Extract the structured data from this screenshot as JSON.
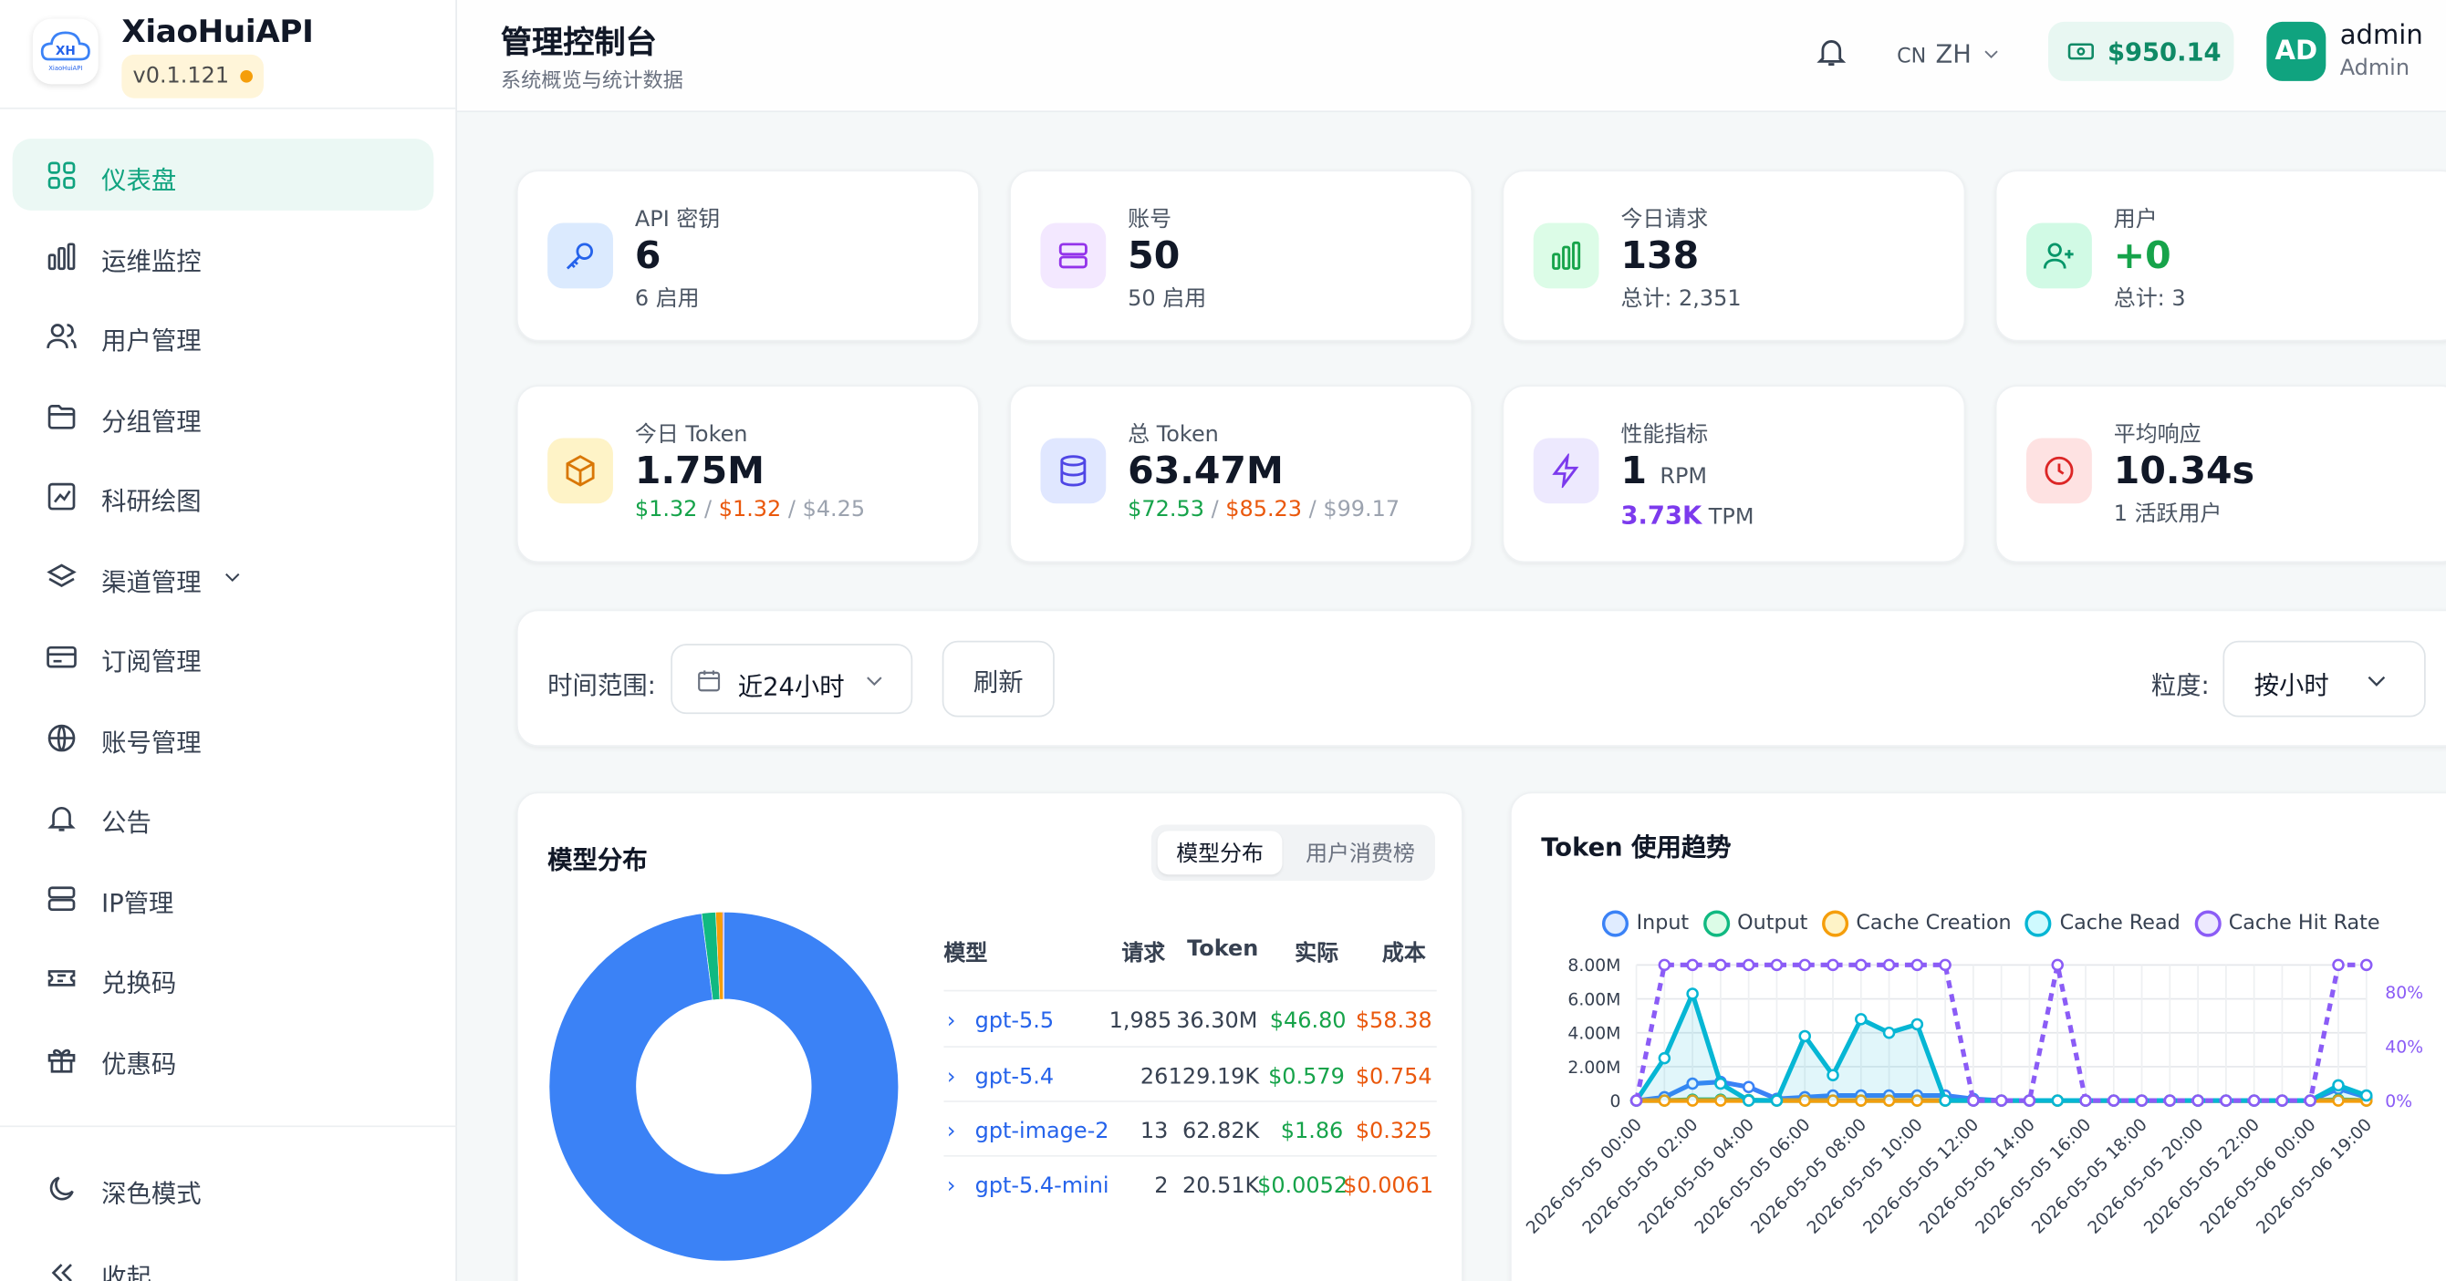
{
  "brand": {
    "name": "XiaoHuiAPI",
    "version": "v0.1.121",
    "logo_text": "XH"
  },
  "sidebar": {
    "items": [
      {
        "label": "仪表盘",
        "icon": "dashboard-icon",
        "active": true
      },
      {
        "label": "运维监控",
        "icon": "bar-chart-icon"
      },
      {
        "label": "用户管理",
        "icon": "users-icon"
      },
      {
        "label": "分组管理",
        "icon": "folder-icon"
      },
      {
        "label": "科研绘图",
        "icon": "line-chart-icon"
      },
      {
        "label": "渠道管理",
        "icon": "layers-icon",
        "expandable": true
      },
      {
        "label": "订阅管理",
        "icon": "card-icon"
      },
      {
        "label": "账号管理",
        "icon": "globe-icon"
      },
      {
        "label": "公告",
        "icon": "bell-icon"
      },
      {
        "label": "IP管理",
        "icon": "server-icon"
      },
      {
        "label": "兑换码",
        "icon": "ticket-icon"
      },
      {
        "label": "优惠码",
        "icon": "gift-icon"
      }
    ],
    "bottom": {
      "dark_mode": "深色模式",
      "collapse": "收起"
    }
  },
  "header": {
    "title": "管理控制台",
    "subtitle": "系统概览与统计数据",
    "lang_flag": "CN",
    "lang": "ZH",
    "balance": "$950.14",
    "avatar": "AD",
    "username": "admin",
    "role": "Admin"
  },
  "stats": [
    {
      "label": "API 密钥",
      "value": "6",
      "sub": "6 启用",
      "icon": "key-icon"
    },
    {
      "label": "账号",
      "value": "50",
      "sub": "50 启用",
      "icon": "server-stack-icon"
    },
    {
      "label": "今日请求",
      "value": "138",
      "sub": "总计: 2,351",
      "icon": "bar-chart-icon"
    },
    {
      "label": "用户",
      "value": "+0",
      "sub": "总计: 3",
      "icon": "user-plus-icon"
    },
    {
      "label": "今日 Token",
      "value": "1.75M",
      "sub_a": "$1.32",
      "sub_b": "$1.32",
      "sub_c": "$4.25",
      "icon": "box-icon"
    },
    {
      "label": "总 Token",
      "value": "63.47M",
      "sub_a": "$72.53",
      "sub_b": "$85.23",
      "sub_c": "$99.17",
      "icon": "database-icon"
    },
    {
      "label": "性能指标",
      "value": "1",
      "value_unit": "RPM",
      "sub_value": "3.73K",
      "sub_unit": "TPM",
      "icon": "lightning-icon"
    },
    {
      "label": "平均响应",
      "value": "10.34s",
      "sub": "1 活跃用户",
      "icon": "clock-icon"
    }
  ],
  "filter": {
    "range_label": "时间范围:",
    "range_value": "近24小时",
    "refresh": "刷新",
    "granularity_label": "粒度:",
    "granularity_value": "按小时"
  },
  "model_dist": {
    "title": "模型分布",
    "tabs": [
      "模型分布",
      "用户消费榜"
    ],
    "columns": [
      "模型",
      "请求",
      "Token",
      "实际",
      "成本"
    ],
    "rows": [
      {
        "model": "gpt-5.5",
        "requests": "1,985",
        "tokens": "36.30M",
        "actual": "$46.80",
        "cost": "$58.38"
      },
      {
        "model": "gpt-5.4",
        "requests": "26",
        "tokens": "129.19K",
        "actual": "$0.579",
        "cost": "$0.754"
      },
      {
        "model": "gpt-image-2",
        "requests": "13",
        "tokens": "62.82K",
        "actual": "$1.86",
        "cost": "$0.325"
      },
      {
        "model": "gpt-5.4-mini",
        "requests": "2",
        "tokens": "20.51K",
        "actual": "$0.0052",
        "cost": "$0.0061"
      }
    ]
  },
  "token_trend": {
    "title": "Token 使用趋势"
  },
  "chart_data": [
    {
      "type": "pie",
      "categories": [
        "gpt-5.5",
        "gpt-5.4",
        "gpt-image-2",
        "gpt-5.4-mini"
      ],
      "values": [
        1985,
        26,
        13,
        2
      ],
      "colors": [
        "#3b82f6",
        "#10b981",
        "#f59e0b",
        "#8b5cf6"
      ]
    },
    {
      "type": "line",
      "x": [
        "2026-05-05 00:00",
        "2026-05-05 01:00",
        "2026-05-05 02:00",
        "2026-05-05 03:00",
        "2026-05-05 04:00",
        "2026-05-05 05:00",
        "2026-05-05 06:00",
        "2026-05-05 07:00",
        "2026-05-05 08:00",
        "2026-05-05 09:00",
        "2026-05-05 10:00",
        "2026-05-05 11:00",
        "2026-05-05 12:00",
        "2026-05-05 13:00",
        "2026-05-05 14:00",
        "2026-05-05 15:00",
        "2026-05-05 16:00",
        "2026-05-05 17:00",
        "2026-05-05 18:00",
        "2026-05-05 19:00",
        "2026-05-05 20:00",
        "2026-05-05 21:00",
        "2026-05-05 22:00",
        "2026-05-05 23:00",
        "2026-05-06 00:00",
        "2026-05-06 19:00",
        "2026-05-06 20:00"
      ],
      "x_tick_labels": [
        "2026-05-05 00:00",
        "2026-05-05 02:00",
        "2026-05-05 04:00",
        "2026-05-05 06:00",
        "2026-05-05 08:00",
        "2026-05-05 10:00",
        "2026-05-05 12:00",
        "2026-05-05 14:00",
        "2026-05-05 16:00",
        "2026-05-05 18:00",
        "2026-05-05 20:00",
        "2026-05-05 22:00",
        "2026-05-06 00:00",
        "2026-05-06 19:00"
      ],
      "y_ticks": [
        "0",
        "2.00M",
        "4.00M",
        "6.00M",
        "8.00M"
      ],
      "y2_ticks": [
        "0%",
        "40%",
        "80%"
      ],
      "ylim": [
        0,
        8000000
      ],
      "y2lim": [
        0,
        100
      ],
      "series": [
        {
          "name": "Input",
          "color": "#3b82f6",
          "axis": "left",
          "values": [
            0,
            200000,
            1000000,
            1100000,
            800000,
            100000,
            200000,
            300000,
            300000,
            300000,
            300000,
            300000,
            100000,
            0,
            0,
            0,
            0,
            0,
            0,
            0,
            0,
            0,
            0,
            0,
            0,
            700000,
            200000
          ]
        },
        {
          "name": "Output",
          "color": "#10b981",
          "axis": "left",
          "values": [
            0,
            0,
            50000,
            50000,
            30000,
            0,
            0,
            0,
            0,
            0,
            0,
            0,
            0,
            0,
            0,
            0,
            0,
            0,
            0,
            0,
            0,
            0,
            0,
            0,
            0,
            50000,
            0
          ]
        },
        {
          "name": "Cache Creation",
          "color": "#f59e0b",
          "axis": "left",
          "values": [
            0,
            0,
            0,
            0,
            0,
            0,
            0,
            0,
            0,
            0,
            0,
            0,
            0,
            0,
            0,
            0,
            0,
            0,
            0,
            0,
            0,
            0,
            0,
            0,
            0,
            0,
            0
          ]
        },
        {
          "name": "Cache Read",
          "color": "#06b6d4",
          "axis": "left",
          "values": [
            0,
            2500000,
            6300000,
            1000000,
            0,
            0,
            3800000,
            1500000,
            4800000,
            4000000,
            4500000,
            0,
            0,
            0,
            0,
            0,
            0,
            0,
            0,
            0,
            0,
            0,
            0,
            0,
            0,
            900000,
            300000
          ]
        },
        {
          "name": "Cache Hit Rate",
          "color": "#8b5cf6",
          "axis": "right",
          "dashed": true,
          "values": [
            0,
            100,
            100,
            100,
            100,
            100,
            100,
            100,
            100,
            100,
            100,
            100,
            0,
            0,
            0,
            100,
            0,
            0,
            0,
            0,
            0,
            0,
            0,
            0,
            0,
            100,
            100
          ]
        }
      ]
    }
  ]
}
